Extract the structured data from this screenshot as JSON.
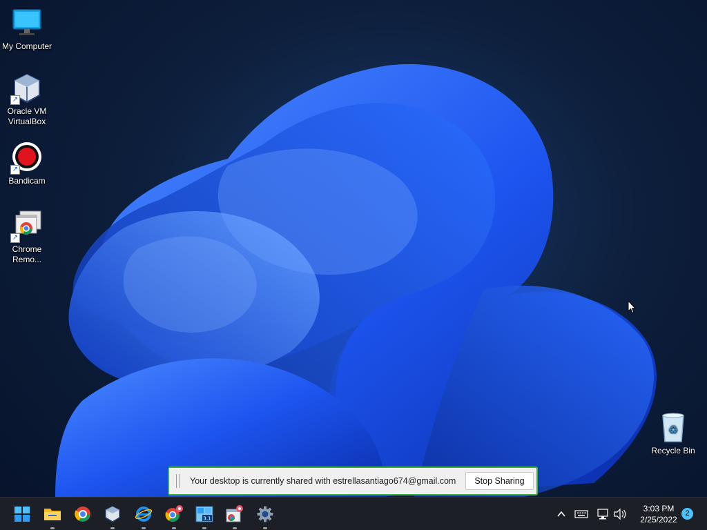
{
  "desktop": {
    "icons": [
      {
        "label": "My Computer",
        "icon": "monitor-icon"
      },
      {
        "label": "Oracle VM\nVirtualBox",
        "icon": "virtualbox-icon"
      },
      {
        "label": "Bandicam",
        "icon": "bandicam-icon"
      },
      {
        "label": "Chrome\nRemo...",
        "icon": "chrome-remote-desktop-icon"
      },
      {
        "label": "Recycle Bin",
        "icon": "recycle-bin-icon"
      }
    ]
  },
  "share_bar": {
    "message": "Your desktop is currently shared with estrellasantiago674@gmail.com",
    "stop_label": "Stop Sharing"
  },
  "taskbar": {
    "apps": [
      {
        "name": "start-icon"
      },
      {
        "name": "file-explorer-icon"
      },
      {
        "name": "chrome-icon"
      },
      {
        "name": "virtualbox-icon"
      },
      {
        "name": "internet-explorer-icon"
      },
      {
        "name": "chrome-remote-icon"
      },
      {
        "name": "windows-3-1-icon",
        "text": "3.1"
      },
      {
        "name": "control-panel-icon"
      },
      {
        "name": "settings-gear-icon"
      }
    ],
    "clock": {
      "time": "3:03 PM",
      "date": "2/25/2022"
    },
    "notification_count": "2"
  },
  "colors": {
    "accent": "#3cb043",
    "wallpaper_blue": "#1e5bff",
    "taskbar": "#1c1f26"
  }
}
